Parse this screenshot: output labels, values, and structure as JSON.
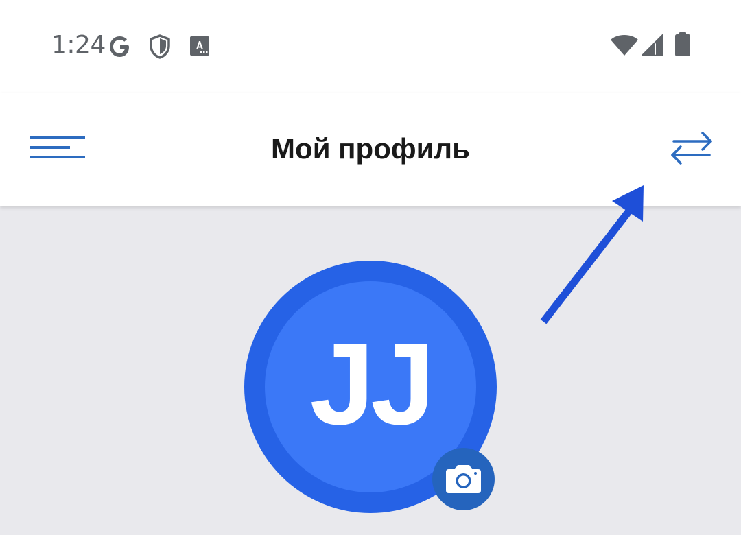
{
  "status_bar": {
    "time": "1:24",
    "left_icons": [
      "google-icon",
      "shield-icon",
      "text-accessibility-icon"
    ],
    "right_icons": [
      "wifi-icon",
      "cell-signal-icon",
      "battery-icon"
    ]
  },
  "app_bar": {
    "title": "Мой профиль",
    "menu_icon": "hamburger-menu-icon",
    "action_icon": "swap-arrows-icon"
  },
  "profile": {
    "initials": "JJ",
    "avatar_color": "#3b78f7",
    "avatar_ring_color": "#2662e6",
    "camera_icon": "camera-icon",
    "camera_button_color": "#2564bd"
  },
  "annotation": {
    "icon": "pointer-arrow-icon",
    "color": "#1e4fd8"
  },
  "colors": {
    "accent": "#2d6cc0",
    "background": "#e9e9ed",
    "surface": "#ffffff"
  }
}
